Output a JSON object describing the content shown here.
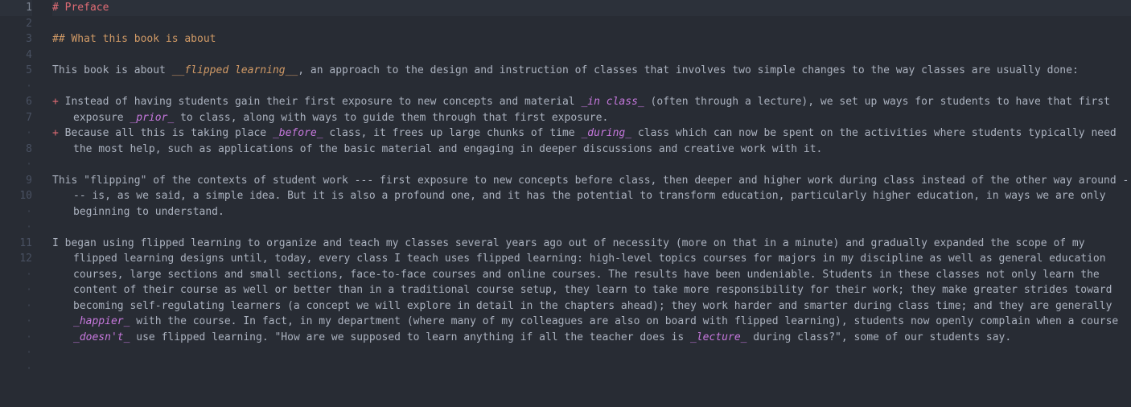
{
  "gutter": {
    "lines": [
      "1",
      "2",
      "3",
      "4",
      "5",
      "·",
      "6",
      "7",
      "·",
      "8",
      "·",
      "9",
      "10",
      "·",
      "·",
      "11",
      "12",
      "·",
      "·",
      "·",
      "·",
      "·",
      "·",
      "·"
    ],
    "current_index": 0
  },
  "code": {
    "rows": [
      {
        "tokens": [
          {
            "cls": "h1",
            "t": "# Preface"
          }
        ],
        "current": true
      },
      {
        "tokens": []
      },
      {
        "tokens": [
          {
            "cls": "h2",
            "t": "## What this book is about"
          }
        ]
      },
      {
        "tokens": []
      },
      {
        "tokens": [
          {
            "cls": "txt",
            "t": "This book is about "
          },
          {
            "cls": "bold-em",
            "t": "__flipped learning__"
          },
          {
            "cls": "txt",
            "t": ", an approach to the design and instruction of classes that involves two simple changes to the way classes are usually done:"
          }
        ]
      },
      {
        "tokens": []
      },
      {
        "tokens": [
          {
            "cls": "bullet",
            "t": "+ "
          },
          {
            "cls": "txt",
            "t": "Instead of having students gain their first exposure to new concepts and material "
          },
          {
            "cls": "em",
            "t": "_in class_"
          },
          {
            "cls": "txt",
            "t": " (often through a lecture), we set up ways for students to have that first exposure "
          },
          {
            "cls": "em",
            "t": "_prior_"
          },
          {
            "cls": "txt",
            "t": " to class, along with ways to guide them through that first exposure."
          }
        ]
      },
      {
        "tokens": [
          {
            "cls": "bullet",
            "t": "+ "
          },
          {
            "cls": "txt",
            "t": "Because all this is taking place "
          },
          {
            "cls": "em",
            "t": "_before_"
          },
          {
            "cls": "txt",
            "t": " class, it frees up large chunks of time "
          },
          {
            "cls": "em",
            "t": "_during_"
          },
          {
            "cls": "txt",
            "t": " class which can now be spent on the activities where students typically need the most help, such as applications of the basic material and engaging in deeper discussions and creative work with it."
          }
        ]
      },
      {
        "tokens": []
      },
      {
        "tokens": [
          {
            "cls": "txt",
            "t": "This \"flipping\" of the contexts of student work --- first exposure to new concepts before class, then deeper and higher work during class instead of the other way around --- is, as we said, a simple idea. But it is also a profound one, and it has the potential to transform education, particularly higher education, in ways we are only beginning to understand."
          }
        ]
      },
      {
        "tokens": []
      },
      {
        "tokens": [
          {
            "cls": "txt",
            "t": "I began using flipped learning to organize and teach my classes several years ago out of necessity (more on that in a minute) and gradually expanded the scope of my flipped learning designs until, today, every class I teach uses flipped learning: high-level topics courses for majors in my discipline as well as general education courses, large sections and small sections, face-to-face courses and online courses. The results have been undeniable. Students in these classes not only learn the content of their course as well or better than in a traditional course setup, they learn to take more responsibility for their work; they make greater strides toward becoming self-regulating learners (a concept we will explore in detail in the chapters ahead); they work harder and smarter during class time; and they are generally "
          },
          {
            "cls": "em",
            "t": "_happier_"
          },
          {
            "cls": "txt",
            "t": " with the course. In fact, in my department (where many of my colleagues are also on board with flipped learning), students now openly complain when a course "
          },
          {
            "cls": "em",
            "t": "_doesn't_"
          },
          {
            "cls": "txt",
            "t": " use flipped learning. \"How are we supposed to learn anything if all the teacher does is "
          },
          {
            "cls": "em",
            "t": "_lecture_"
          },
          {
            "cls": "txt",
            "t": " during class?\", some of our students say."
          }
        ]
      }
    ]
  }
}
